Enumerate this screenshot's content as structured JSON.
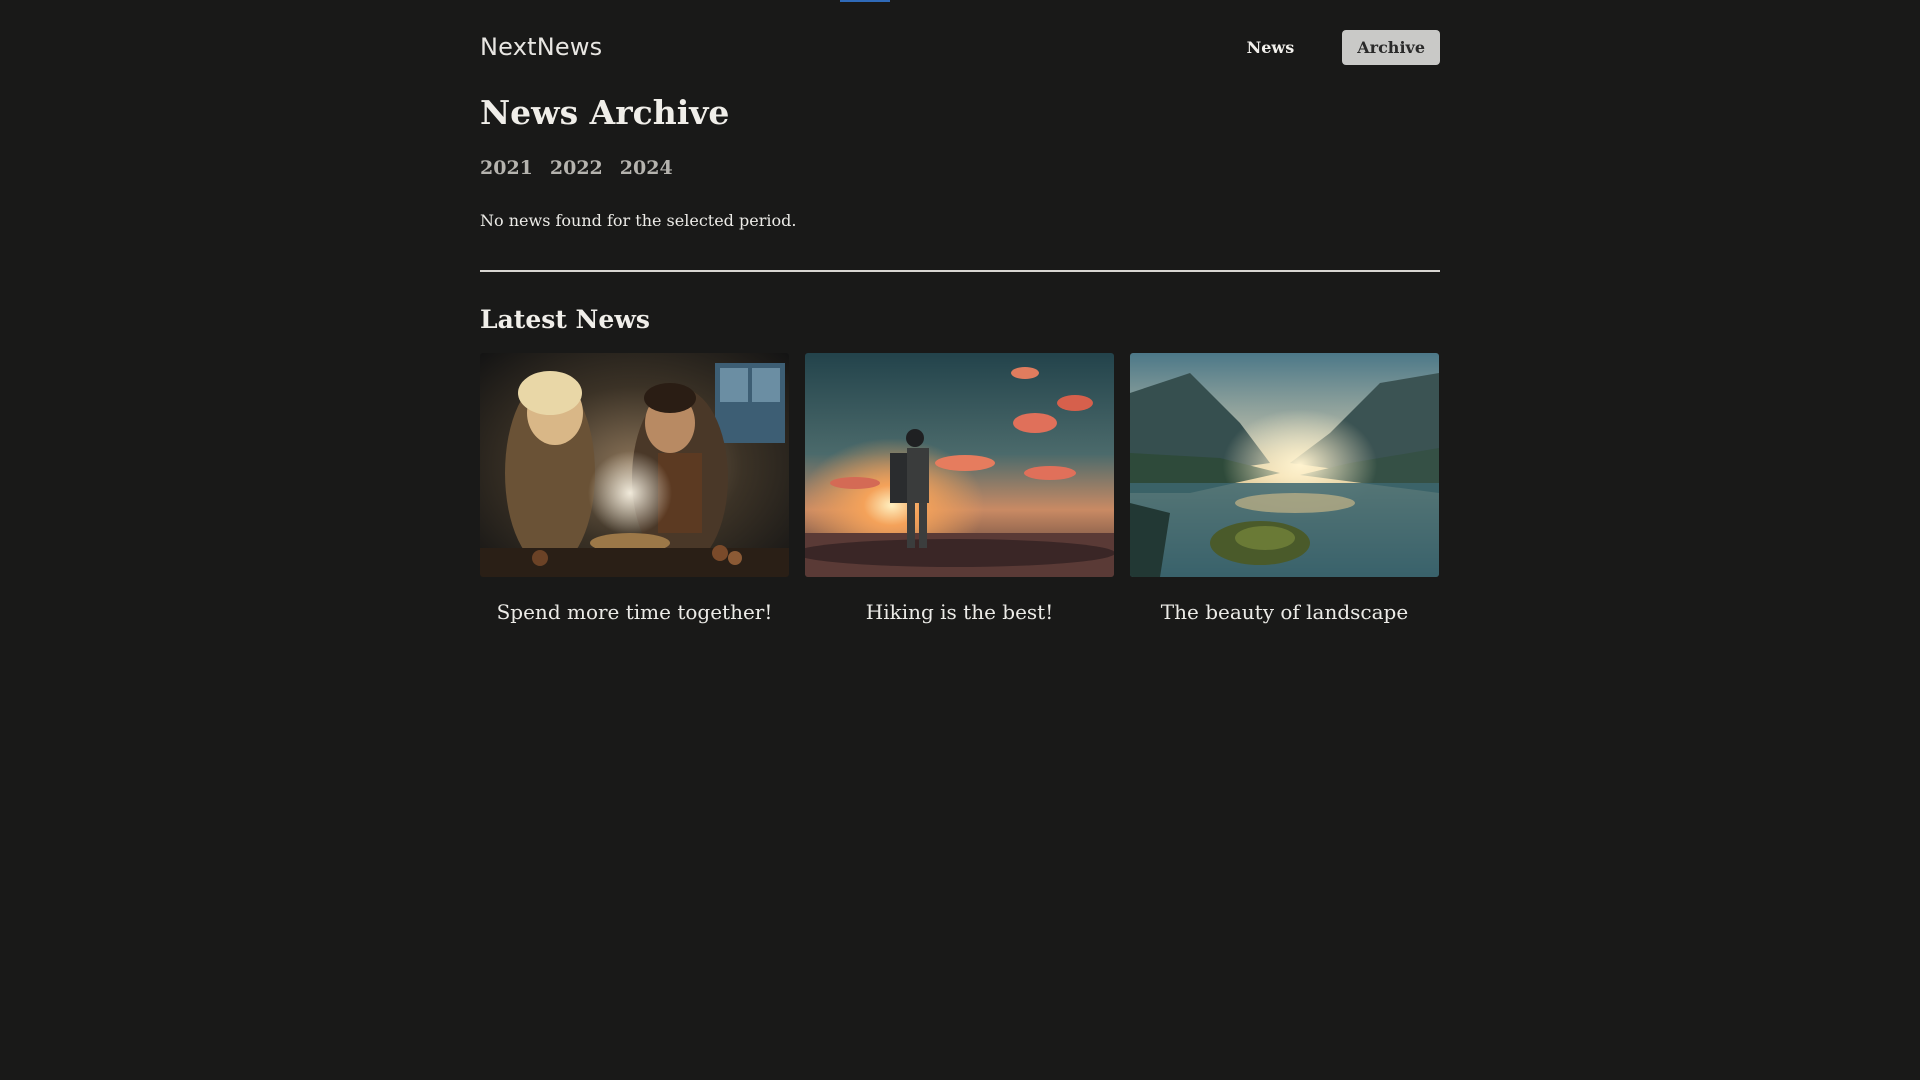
{
  "header": {
    "logo": "NextNews",
    "nav": [
      {
        "label": "News"
      },
      {
        "label": "Archive"
      }
    ]
  },
  "archive": {
    "title": "News Archive",
    "years": [
      "2021",
      "2022",
      "2024"
    ],
    "empty_message": "No news found for the selected period."
  },
  "latest": {
    "title": "Latest News",
    "cards": [
      {
        "title": "Spend more time together!",
        "image": "couple-cooking-image"
      },
      {
        "title": "Hiking is the best!",
        "image": "hiker-sunset-image"
      },
      {
        "title": "The beauty of landscape",
        "image": "mountain-lake-image"
      }
    ]
  },
  "colors": {
    "background": "#191918",
    "active_nav_bg": "#c9c9c7",
    "progress": "#2f6ab8"
  }
}
